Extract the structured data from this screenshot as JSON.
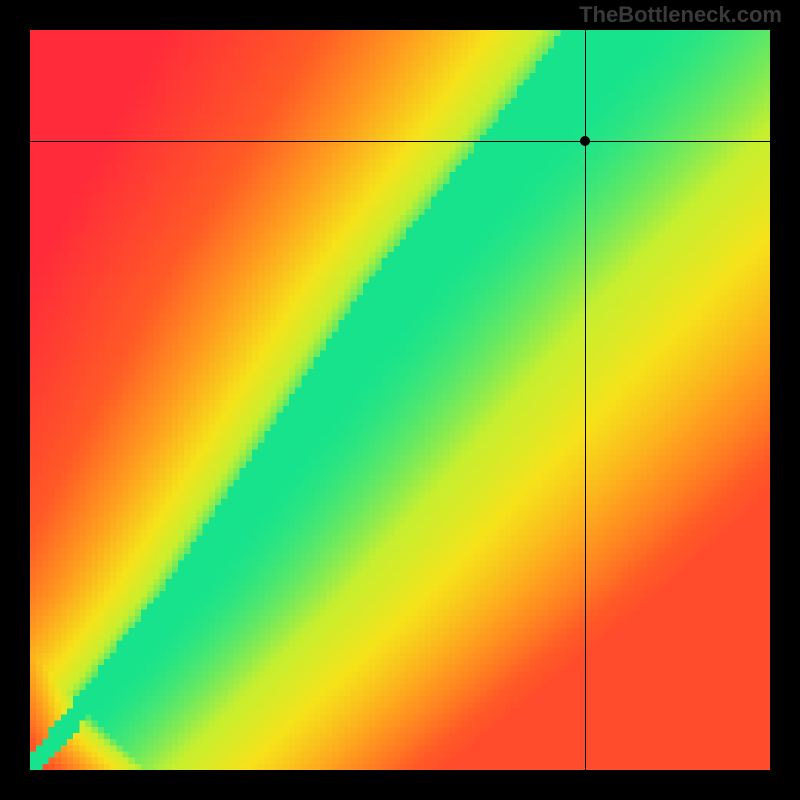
{
  "watermark": "TheBottleneck.com",
  "chart_data": {
    "type": "heatmap",
    "title": "",
    "xlabel": "",
    "ylabel": "",
    "xlim": [
      0,
      100
    ],
    "ylim": [
      0,
      100
    ],
    "colorscale_description": "red (bad) → orange → yellow → green (optimal) → yellow → orange",
    "ridge_description": "Optimal (green) band along a near-vertical curve starting at the origin, bending slightly and rising steeply to exit near the top around x≈75–80; surrounded by yellow transition, fading to red on the left and orange/yellow on the right.",
    "crosshair": {
      "x": 75,
      "y": 85
    },
    "marker": {
      "x": 75,
      "y": 85
    },
    "grid_size": 120,
    "color_stops": [
      {
        "t": 0.0,
        "hex": "#ff2a3a"
      },
      {
        "t": 0.35,
        "hex": "#ff5a26"
      },
      {
        "t": 0.55,
        "hex": "#ff9a1f"
      },
      {
        "t": 0.75,
        "hex": "#f6e21a"
      },
      {
        "t": 0.88,
        "hex": "#c6ef2f"
      },
      {
        "t": 1.0,
        "hex": "#17e38c"
      }
    ],
    "ridge_points_xy": [
      [
        0,
        0
      ],
      [
        5,
        6
      ],
      [
        10,
        12
      ],
      [
        15,
        18
      ],
      [
        20,
        24
      ],
      [
        25,
        31
      ],
      [
        30,
        38
      ],
      [
        35,
        45
      ],
      [
        40,
        52
      ],
      [
        45,
        59
      ],
      [
        50,
        66
      ],
      [
        55,
        72
      ],
      [
        60,
        78
      ],
      [
        65,
        84
      ],
      [
        70,
        90
      ],
      [
        74,
        95
      ],
      [
        78,
        100
      ]
    ],
    "side_asymmetry": {
      "left_falloff": 0.9,
      "right_falloff": 1.6
    }
  }
}
